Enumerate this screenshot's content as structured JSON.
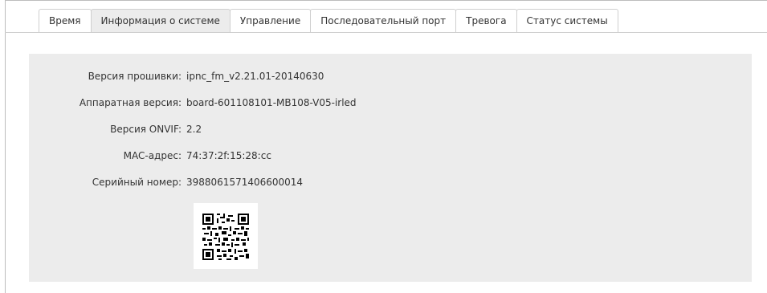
{
  "tabs": [
    {
      "label": "Время",
      "active": false
    },
    {
      "label": "Информация о системе",
      "active": true
    },
    {
      "label": "Управление",
      "active": false
    },
    {
      "label": "Последовательный порт",
      "active": false
    },
    {
      "label": "Тревога",
      "active": false
    },
    {
      "label": "Статус системы",
      "active": false
    }
  ],
  "info": {
    "firmware": {
      "label": "Версия прошивки:",
      "value": "ipnc_fm_v2.21.01-20140630"
    },
    "hardware": {
      "label": "Аппаратная версия:",
      "value": "board-601108101-MB108-V05-irled"
    },
    "onvif": {
      "label": "Версия ONVIF:",
      "value": "2.2"
    },
    "mac": {
      "label": "MAC-адрес:",
      "value": "74:37:2f:15:28:cc"
    },
    "serial": {
      "label": "Серийный номер:",
      "value": "3988061571406600014"
    }
  },
  "colors": {
    "panel_bg": "#ececec",
    "active_tab_bg": "#ececec",
    "text": "#333333"
  }
}
